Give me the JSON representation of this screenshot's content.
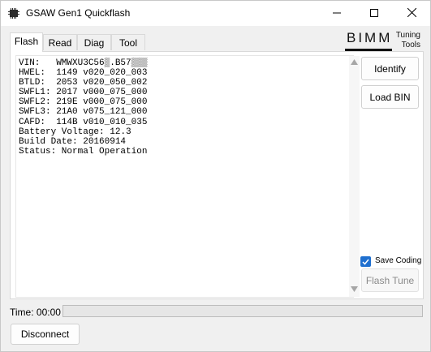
{
  "window": {
    "title": "GSAW Gen1 Quickflash",
    "icons": [
      "chip-icon",
      "minimize-icon",
      "maximize-icon",
      "close-icon"
    ]
  },
  "tabs": [
    {
      "label": "Flash",
      "active": true
    },
    {
      "label": "Read",
      "active": false
    },
    {
      "label": "Diag",
      "active": false
    },
    {
      "label": "Tool",
      "active": false
    }
  ],
  "logo": {
    "brand": "BIMM",
    "tagline_line1": "Tuning",
    "tagline_line2": "Tools"
  },
  "log": {
    "lines": [
      "VIN:   WMWXU3C56▒.B57▒▒▒",
      "HWEL:  1149 v020_020_003",
      "BTLD:  2053 v020_050_002",
      "SWFL1: 2017 v000_075_000",
      "SWFL2: 219E v000_075_000",
      "SWFL3: 21A0 v075_121_000",
      "CAFD:  114B v010_010_035",
      "Battery Voltage: 12.3",
      "Build Date: 20160914",
      "Status: Normal Operation"
    ]
  },
  "buttons": {
    "identify": "Identify",
    "load_bin": "Load BIN",
    "flash_tune": "Flash Tune",
    "disconnect": "Disconnect"
  },
  "save_coding": {
    "label": "Save Coding",
    "checked": true
  },
  "status": {
    "time_label": "Time: 00:00",
    "progress_fraction": 0
  },
  "colors": {
    "accent": "#1f6fcf",
    "progress": "#06b025"
  }
}
